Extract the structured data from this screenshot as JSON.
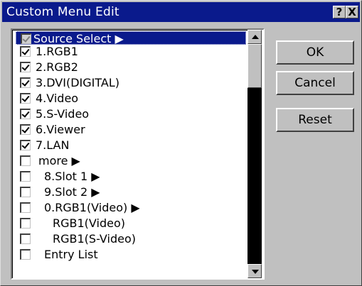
{
  "window": {
    "title": "Custom Menu Edit",
    "help_label": "?",
    "close_label": "X"
  },
  "list": {
    "items": [
      {
        "label": "Source Select ▶",
        "checked": true,
        "selected": true
      },
      {
        "label": "1.RGB1",
        "checked": true
      },
      {
        "label": "2.RGB2",
        "checked": true
      },
      {
        "label": "3.DVI(DIGITAL)",
        "checked": true
      },
      {
        "label": "4.Video",
        "checked": true
      },
      {
        "label": "5.S-Video",
        "checked": true
      },
      {
        "label": "6.Viewer",
        "checked": true
      },
      {
        "label": "7.LAN",
        "checked": true
      },
      {
        "label": "more ▶",
        "checked": false
      },
      {
        "label": "8.Slot 1 ▶",
        "checked": false
      },
      {
        "label": "9.Slot 2 ▶",
        "checked": false
      },
      {
        "label": "0.RGB1(Video) ▶",
        "checked": false
      },
      {
        "label": "RGB1(Video)",
        "checked": false
      },
      {
        "label": "RGB1(S-Video)",
        "checked": false
      },
      {
        "label": "Entry List",
        "checked": false
      }
    ]
  },
  "buttons": {
    "ok_label": "OK",
    "cancel_label": "Cancel",
    "reset_label": "Reset"
  },
  "colors": {
    "titlebar": "#0a1a8c",
    "selection": "#0a1a8c",
    "face": "#c0c0c0"
  }
}
